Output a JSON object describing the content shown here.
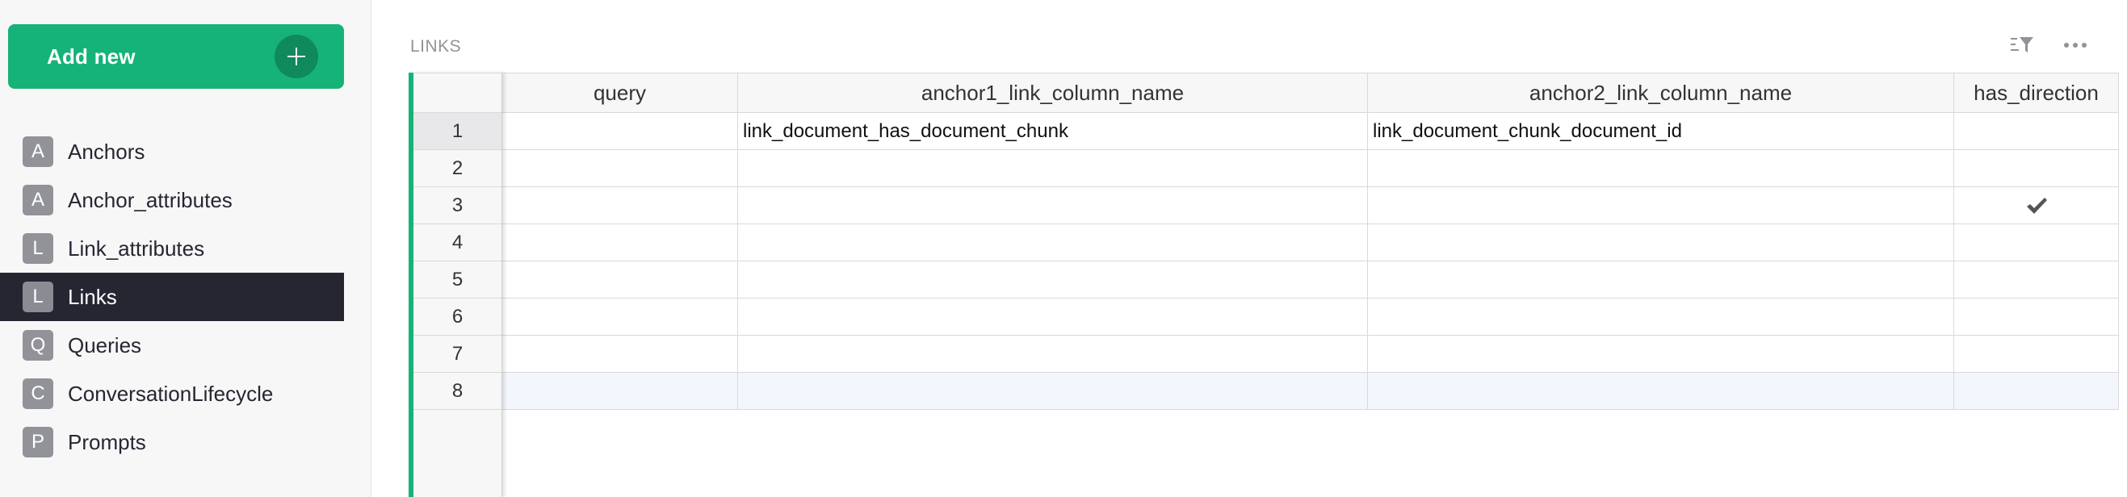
{
  "sidebar": {
    "add_new_label": "Add new",
    "pages": [
      {
        "initial": "A",
        "name": "Anchors",
        "active": false
      },
      {
        "initial": "A",
        "name": "Anchor_attributes",
        "active": false
      },
      {
        "initial": "L",
        "name": "Link_attributes",
        "active": false
      },
      {
        "initial": "L",
        "name": "Links",
        "active": true
      },
      {
        "initial": "Q",
        "name": "Queries",
        "active": false
      },
      {
        "initial": "C",
        "name": "ConversationLifecycle",
        "active": false
      },
      {
        "initial": "P",
        "name": "Prompts",
        "active": false
      }
    ]
  },
  "main": {
    "section_title": "LINKS",
    "toolbar": {
      "sort_filter_icon": "sort-filter-icon",
      "more_icon": "more-options-icon"
    }
  },
  "table": {
    "columns": [
      "query",
      "anchor1_link_column_name",
      "anchor2_link_column_name",
      "has_direction"
    ],
    "rows": [
      {
        "num": "1",
        "query": "",
        "anchor1": "link_document_has_document_chunk",
        "anchor2": "link_document_chunk_document_id",
        "has_direction": false
      },
      {
        "num": "2",
        "query": "",
        "anchor1": "",
        "anchor2": "",
        "has_direction": false
      },
      {
        "num": "3",
        "query": "",
        "anchor1": "",
        "anchor2": "",
        "has_direction": true
      },
      {
        "num": "4",
        "query": "",
        "anchor1": "",
        "anchor2": "",
        "has_direction": false
      },
      {
        "num": "5",
        "query": "",
        "anchor1": "",
        "anchor2": "",
        "has_direction": false
      },
      {
        "num": "6",
        "query": "",
        "anchor1": "",
        "anchor2": "",
        "has_direction": false
      },
      {
        "num": "7",
        "query": "",
        "anchor1": "",
        "anchor2": "",
        "has_direction": false
      },
      {
        "num": "8",
        "query": "",
        "anchor1": "",
        "anchor2": "",
        "has_direction": false
      }
    ],
    "active_row": "1",
    "selected_row": "8"
  },
  "colors": {
    "accent": "#16b378",
    "sidebar_active_bg": "#262633",
    "page_initial_bg": "#929299"
  }
}
